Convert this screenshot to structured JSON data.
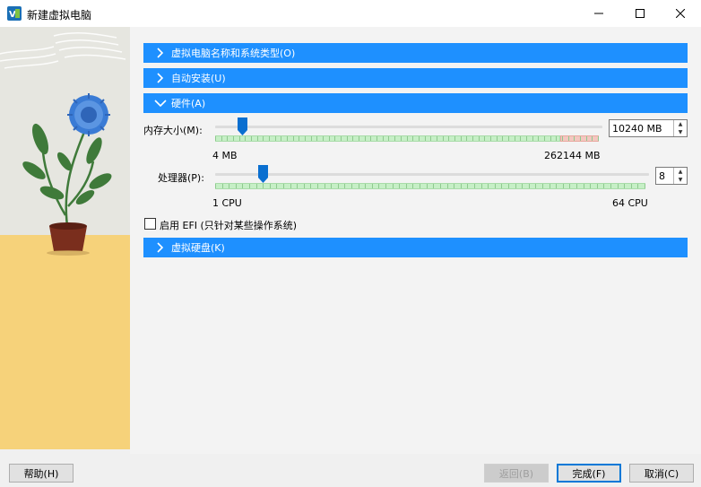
{
  "window": {
    "title": "新建虚拟电脑",
    "minimize_icon": "minimize-icon",
    "maximize_icon": "maximize-icon",
    "close_icon": "close-icon"
  },
  "sections": {
    "name_type": {
      "label": "虚拟电脑名称和系统类型(O)",
      "expanded": false
    },
    "unattended": {
      "label": "自动安装(U)",
      "expanded": false
    },
    "hardware": {
      "label": "硬件(A)",
      "expanded": true
    },
    "disk": {
      "label": "虚拟硬盘(K)",
      "expanded": false
    }
  },
  "hardware": {
    "memory": {
      "label": "内存大小(M):",
      "value": "10240 MB",
      "min_label": "4 MB",
      "max_label": "262144 MB",
      "fraction": 0.039
    },
    "cpu": {
      "label": "处理器(P):",
      "value": "8",
      "min_label": "1 CPU",
      "max_label": "64 CPU",
      "fraction": 0.11
    },
    "efi": {
      "label": "启用 EFI (只针对某些操作系统)",
      "checked": false
    }
  },
  "buttons": {
    "help": "帮助(H)",
    "back": "返回(B)",
    "finish": "完成(F)",
    "cancel": "取消(C)"
  },
  "colors": {
    "accent": "#1e90ff",
    "slider_thumb": "#0a6fd0"
  }
}
